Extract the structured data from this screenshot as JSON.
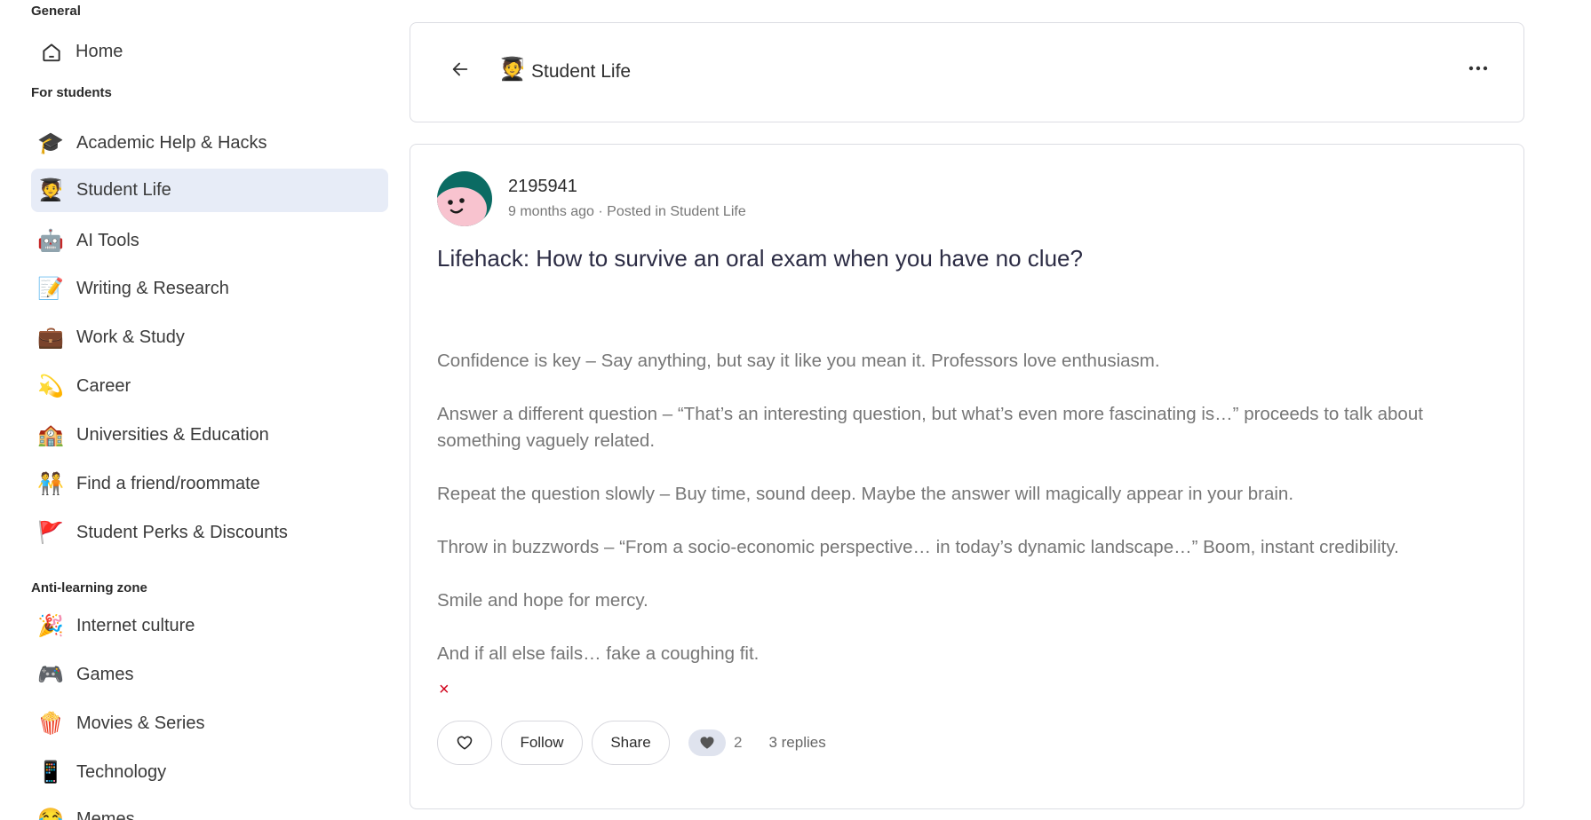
{
  "sidebar": {
    "general_title": "General",
    "home": {
      "label": "Home",
      "icon": "home-icon"
    },
    "students_title": "For students",
    "student_items": [
      {
        "emoji": "🎓",
        "label": "Academic Help & Hacks"
      },
      {
        "emoji": "🧑‍🎓",
        "label": "Student Life",
        "active": true
      },
      {
        "emoji": "🤖",
        "label": "AI Tools"
      },
      {
        "emoji": "📝",
        "label": "Writing & Research"
      },
      {
        "emoji": "💼",
        "label": "Work & Study"
      },
      {
        "emoji": "💫",
        "label": "Career"
      },
      {
        "emoji": "🏫",
        "label": "Universities & Education"
      },
      {
        "emoji": "🧑‍🤝‍🧑",
        "label": "Find a friend/roommate"
      },
      {
        "emoji": "🚩",
        "label": "Student Perks & Discounts"
      }
    ],
    "anti_title": "Anti-learning zone",
    "anti_items": [
      {
        "emoji": "🎉",
        "label": "Internet culture"
      },
      {
        "emoji": "🎮",
        "label": "Games"
      },
      {
        "emoji": "🍿",
        "label": "Movies & Series"
      },
      {
        "emoji": "📱",
        "label": "Technology"
      },
      {
        "emoji": "😂",
        "label": "Memes"
      }
    ]
  },
  "header": {
    "emoji": "🧑‍🎓",
    "title": "Student Life",
    "back_icon": "arrow-left-icon",
    "more_icon": "more-horizontal-icon"
  },
  "post": {
    "author": "2195941",
    "meta": "9 months ago · Posted in Student Life",
    "title": "Lifehack: How to survive an oral exam when you have no clue?",
    "paragraphs": [
      "Confidence is key – Say anything, but say it like you mean it. Professors love enthusiasm.",
      "Answer a different question – “That’s an interesting question, but what’s even more fascinating is…” proceeds to talk about something vaguely related.",
      "Repeat the question slowly – Buy time, sound deep. Maybe the answer will magically appear in your brain.",
      "Throw in buzzwords – “From a socio-economic perspective… in today’s dynamic landscape…” Boom, instant credibility.",
      "Smile and hope for mercy.",
      "And if all else fails… fake a coughing fit."
    ],
    "close_mark": "×",
    "actions": {
      "follow_label": "Follow",
      "share_label": "Share",
      "reaction_count": "2",
      "replies_label": "3 replies"
    }
  },
  "colors": {
    "active_bg": "#e7ecf7",
    "avatar_teal": "#0b6b63",
    "avatar_pink": "#f8c3cf",
    "close_red": "#d0021b"
  }
}
